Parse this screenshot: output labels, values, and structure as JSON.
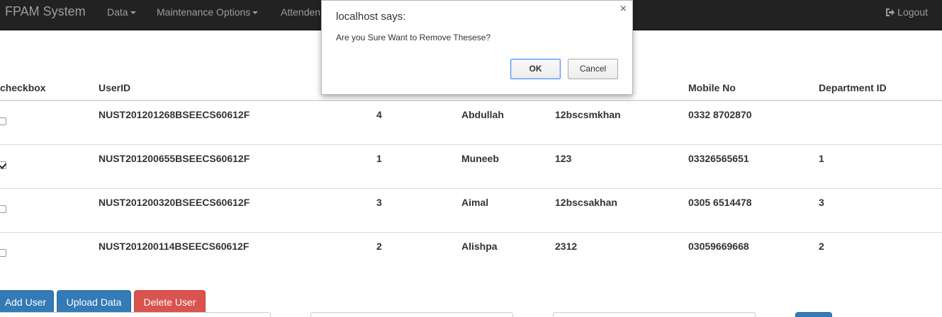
{
  "navbar": {
    "brand": "FPAM System",
    "items": [
      "Data",
      "Maintenance Options",
      "Attenden"
    ],
    "logout": "Logout"
  },
  "table": {
    "columns": [
      "checkbox",
      "UserID",
      "Mobile No",
      "Department ID"
    ],
    "rows": [
      {
        "checked": false,
        "user_id": "NUST201201268BSEECS60612F",
        "num": "4",
        "name": "Abdullah",
        "password": "12bscsmkhan",
        "mobile": "0332 8702870",
        "dept": ""
      },
      {
        "checked": true,
        "user_id": "NUST201200655BSEECS60612F",
        "num": "1",
        "name": "Muneeb",
        "password": "123",
        "mobile": "03326565651",
        "dept": "1"
      },
      {
        "checked": false,
        "user_id": "NUST201200320BSEECS60612F",
        "num": "3",
        "name": "Aimal",
        "password": "12bscsakhan",
        "mobile": "0305 6514478",
        "dept": "3"
      },
      {
        "checked": false,
        "user_id": "NUST201200114BSEECS60612F",
        "num": "2",
        "name": "Alishpa",
        "password": "2312",
        "mobile": "03059669668",
        "dept": "2"
      }
    ]
  },
  "buttons": {
    "add_user": "Add User",
    "upload_data": "Upload Data",
    "delete_user": "Delete User"
  },
  "dialog": {
    "title": "localhost says:",
    "message": "Are you Sure Want to Remove Thesese?",
    "ok": "OK",
    "cancel": "Cancel",
    "close": "×"
  },
  "icons": {
    "logout": "logout-icon",
    "caret": "caret-down-icon",
    "close": "close-icon"
  }
}
